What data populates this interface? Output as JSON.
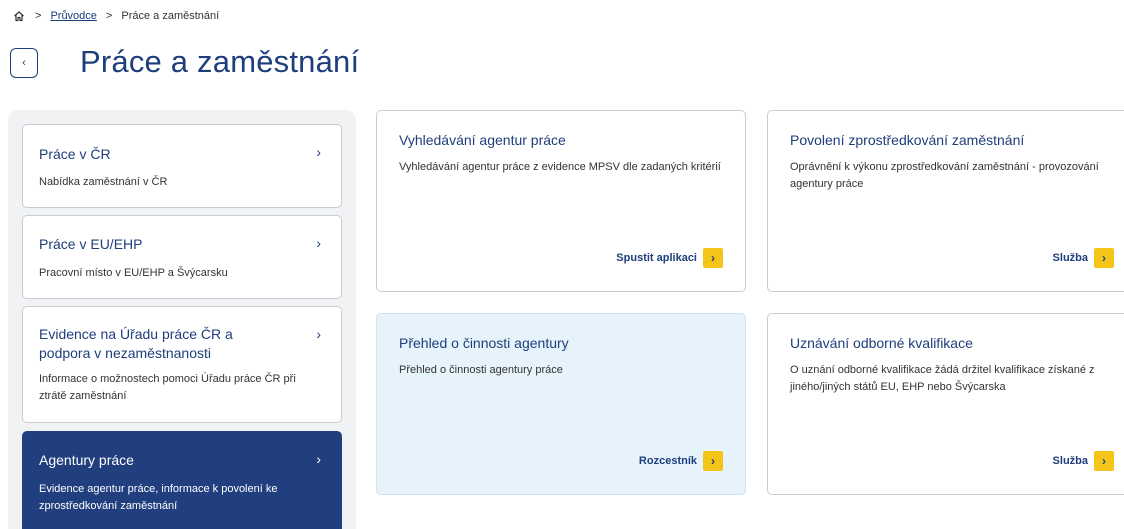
{
  "breadcrumb": {
    "home_icon": "home-icon",
    "sep1": ">",
    "link": "Průvodce",
    "sep2": ">",
    "current": "Práce a zaměstnání"
  },
  "header": {
    "back_label": "‹",
    "title": "Práce a zaměstnání"
  },
  "sidebar": {
    "items": [
      {
        "title": "Práce v ČR",
        "desc": "Nabídka zaměstnání v ČR",
        "chevron": "›",
        "active": false
      },
      {
        "title": "Práce v EU/EHP",
        "desc": "Pracovní místo v EU/EHP a Švýcarsku",
        "chevron": "›",
        "active": false
      },
      {
        "title_line1": "Evidence na Úřadu práce ČR a",
        "title_line2": "podpora v nezaměstnanosti",
        "desc_line1": "Informace o možnostech pomoci Úřadu práce ČR při",
        "desc_line2": "ztrátě zaměstnání",
        "chevron": "›",
        "active": false
      },
      {
        "title": "Agentury práce",
        "desc_line1": "Evidence agentur práce, informace k povolení ke",
        "desc_line2": "zprostředkování zaměstnání",
        "chevron": "›",
        "active": true
      }
    ]
  },
  "cards": [
    {
      "title": "Vyhledávání agentur práce",
      "desc": "Vyhledávání agentur práce z evidence MPSV dle zadaných kritérií",
      "cta": "Spustit aplikaci",
      "arrow": "›"
    },
    {
      "title": "Povolení zprostředkování zaměstnání",
      "desc": "Oprávnění k výkonu zprostředkování zaměstnání - provozování agentury práce",
      "cta": "Služba",
      "arrow": "›"
    },
    {
      "title": "Přehled o činnosti agentury",
      "desc": "Přehled o činnosti agentury práce",
      "cta": "Rozcestník",
      "arrow": "›"
    },
    {
      "title": "Uznávání odborné kvalifikace",
      "desc": "O uznání odborné kvalifikace žádá držitel kvalifikace získané z jiného/jiných států EU, EHP nebo Švýcarska",
      "cta": "Služba",
      "arrow": "›"
    }
  ],
  "colors": {
    "primary": "#1f3e7c",
    "active_bg": "#213f7e",
    "accent": "#f4c518",
    "highlight_bg": "#e6f3fb"
  }
}
